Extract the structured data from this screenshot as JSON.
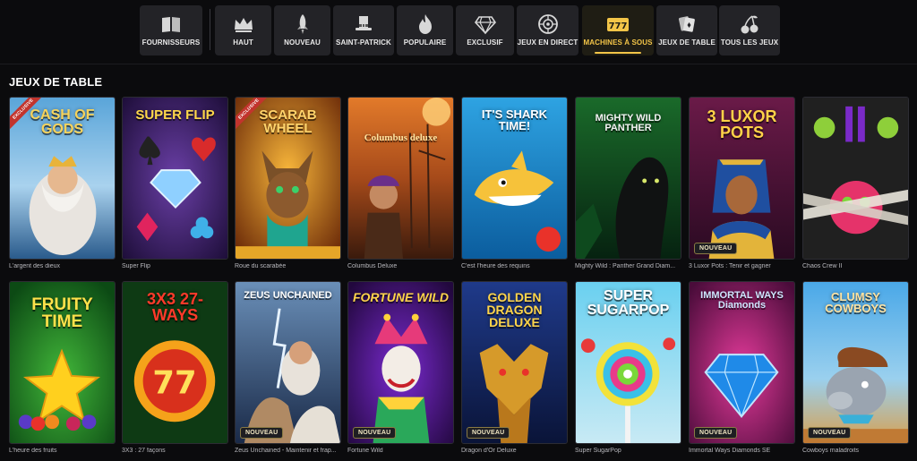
{
  "nav": {
    "items": [
      {
        "label": "FOURNISSEURS",
        "icon": "book-icon"
      },
      {
        "label": "HAUT",
        "icon": "crown-icon"
      },
      {
        "label": "NOUVEAU",
        "icon": "rocket-icon"
      },
      {
        "label": "SAINT-PATRICK",
        "icon": "leprechaun-hat-icon"
      },
      {
        "label": "POPULAIRE",
        "icon": "flame-icon"
      },
      {
        "label": "EXCLUSIF",
        "icon": "diamond-icon"
      },
      {
        "label": "JEUX EN DIRECT",
        "icon": "roulette-icon"
      },
      {
        "label": "MACHINES À SOUS",
        "icon": "slot-777-icon",
        "active": true
      },
      {
        "label": "JEUX DE TABLE",
        "icon": "cards-icon"
      },
      {
        "label": "TOUS LES JEUX",
        "icon": "cherries-icon"
      }
    ],
    "active_color": "#f3c548"
  },
  "section": {
    "title": "JEUX DE TABLE"
  },
  "badges": {
    "exclusive": "EXCLUSIVE",
    "new": "NOUVEAU"
  },
  "games": [
    {
      "logo": "CASH OF GODS",
      "caption": "L'argent des dieux",
      "exclusive": true,
      "new": false
    },
    {
      "logo": "SUPER FLIP",
      "caption": "Super Flip",
      "exclusive": false,
      "new": false
    },
    {
      "logo": "SCARAB WHEEL",
      "caption": "Roue du scarabée",
      "exclusive": true,
      "new": false
    },
    {
      "logo": "Columbus deluxe",
      "caption": "Columbus Deluxe",
      "exclusive": false,
      "new": false
    },
    {
      "logo": "IT'S SHARK TIME!",
      "caption": "C'est l'heure des requins",
      "exclusive": false,
      "new": false
    },
    {
      "logo": "MIGHTY WILD PANTHER",
      "caption": "Mighty Wild : Panther Grand Diam...",
      "exclusive": false,
      "new": false
    },
    {
      "logo": "3 LUXOR POTS",
      "caption": "3 Luxor Pots : Tenir et gagner",
      "exclusive": false,
      "new": true
    },
    {
      "logo": "",
      "caption": "Chaos Crew II",
      "exclusive": false,
      "new": false
    },
    {
      "logo": "FRUITY TIME",
      "caption": "L'heure des fruits",
      "exclusive": false,
      "new": false
    },
    {
      "logo": "3X3 27-WAYS",
      "caption": "3X3 : 27 façons",
      "exclusive": false,
      "new": false
    },
    {
      "logo": "ZEUS UNCHAINED",
      "caption": "Zeus Unchained - Maintenir et frap...",
      "exclusive": false,
      "new": true
    },
    {
      "logo": "FORTUNE WILD",
      "caption": "Fortune Wild",
      "exclusive": false,
      "new": true
    },
    {
      "logo": "GOLDEN DRAGON DELUXE",
      "caption": "Dragon d'Or Deluxe",
      "exclusive": false,
      "new": true
    },
    {
      "logo": "SUPER SUGARPOP",
      "caption": "Super SugarPop",
      "exclusive": false,
      "new": false
    },
    {
      "logo": "IMMORTAL WAYS Diamonds",
      "caption": "Immortal Ways Diamonds SE",
      "exclusive": false,
      "new": true
    },
    {
      "logo": "CLUMSY COWBOYS",
      "caption": "Cowboys maladroits",
      "exclusive": false,
      "new": true
    }
  ]
}
